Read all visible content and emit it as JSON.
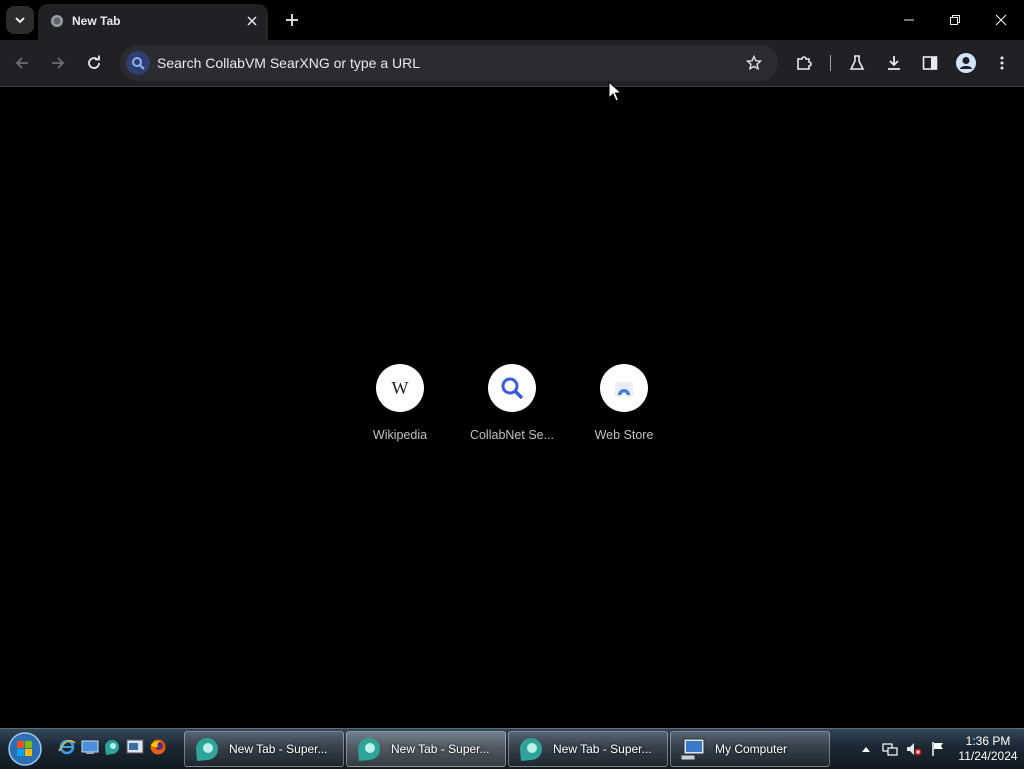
{
  "browser": {
    "tab": {
      "title": "New Tab"
    },
    "omnibox": {
      "placeholder": "Search CollabVM SearXNG or type a URL"
    },
    "accent": "#8ab4f8"
  },
  "shortcuts": [
    {
      "label": "Wikipedia",
      "icon": "wikipedia-icon",
      "glyph": "W"
    },
    {
      "label": "CollabNet Se...",
      "icon": "search-icon"
    },
    {
      "label": "Web Store",
      "icon": "web-store-icon"
    }
  ],
  "taskbar": {
    "tasks": [
      {
        "label": "New Tab - Super...",
        "icon": "browser-icon"
      },
      {
        "label": "New Tab - Super...",
        "icon": "browser-icon"
      },
      {
        "label": "New Tab - Super...",
        "icon": "browser-icon"
      },
      {
        "label": "My Computer",
        "icon": "computer-icon"
      }
    ],
    "clock": {
      "time": "1:36 PM",
      "date": "11/24/2024"
    }
  }
}
